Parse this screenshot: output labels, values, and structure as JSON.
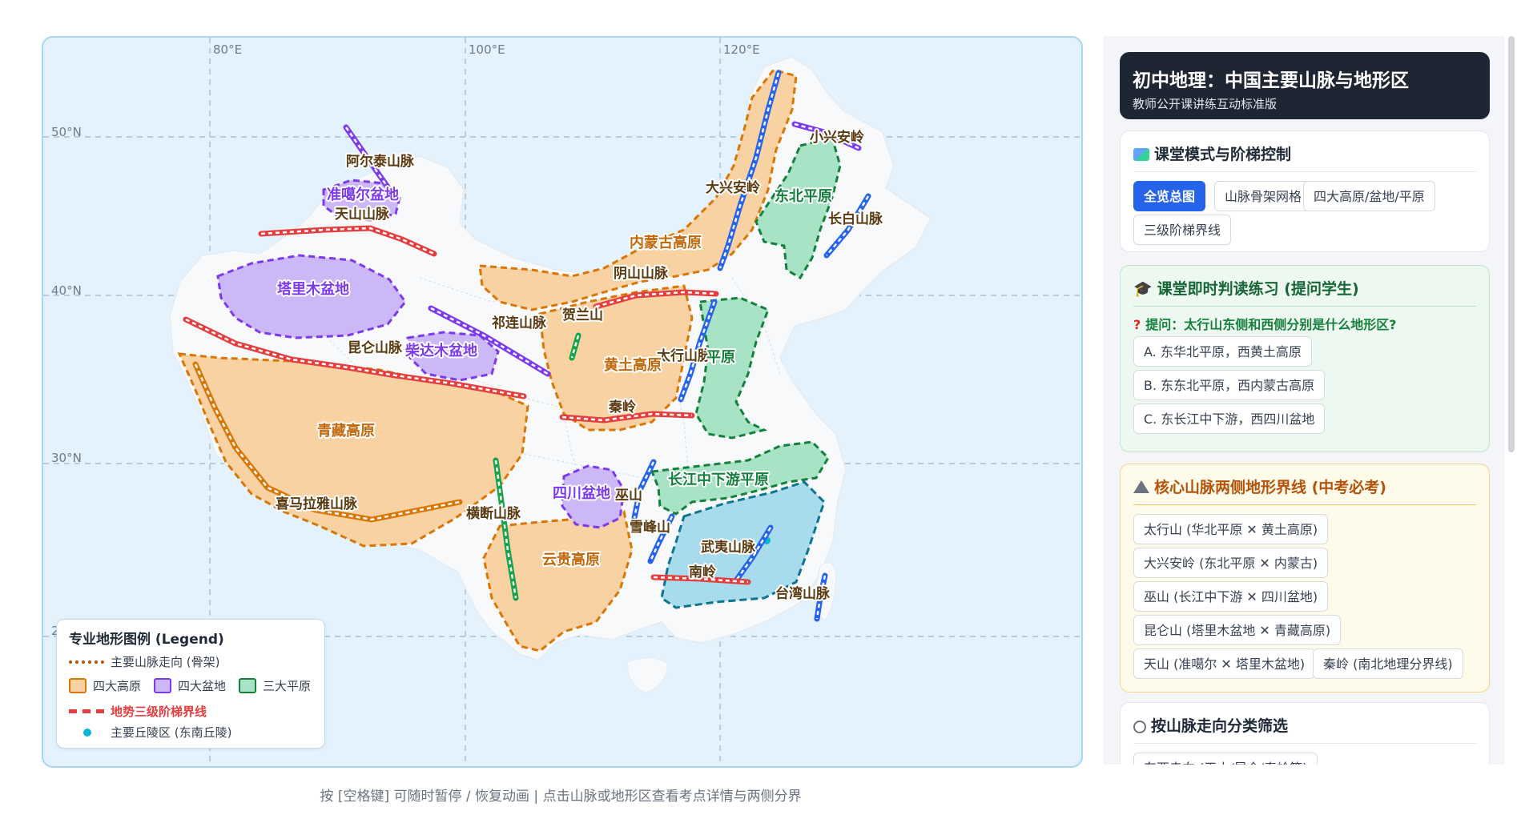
{
  "map": {
    "graticule": {
      "lon_labels": [
        "80°E",
        "100°E",
        "120°E"
      ],
      "lat_labels": [
        "50°N",
        "40°N",
        "30°N",
        "2"
      ]
    },
    "mountains": [
      {
        "id": "altai",
        "label": "阿尔泰山脉",
        "direction": "northwest-southeast",
        "color": "#7c3aed"
      },
      {
        "id": "tianshan",
        "label": "天山山脉",
        "direction": "east-west",
        "color": "#e53e3e"
      },
      {
        "id": "kunlun",
        "label": "昆仑山脉",
        "direction": "east-west",
        "color": "#e53e3e"
      },
      {
        "id": "qilian",
        "label": "祁连山脉",
        "direction": "northwest-southeast",
        "color": "#7c3aed"
      },
      {
        "id": "helan",
        "label": "贺兰山",
        "direction": "north-south",
        "color": "#16a34a"
      },
      {
        "id": "yinshan",
        "label": "阴山山脉",
        "direction": "east-west",
        "color": "#e53e3e"
      },
      {
        "id": "daxinganling",
        "label": "大兴安岭",
        "direction": "northeast-southwest",
        "color": "#2563eb"
      },
      {
        "id": "xiaoxinganling",
        "label": "小兴安岭",
        "direction": "northwest-southeast",
        "color": "#7c3aed"
      },
      {
        "id": "changbai",
        "label": "长白山脉",
        "direction": "northeast-southwest",
        "color": "#2563eb"
      },
      {
        "id": "taihang",
        "label": "太行山脉",
        "direction": "northeast-southwest",
        "color": "#2563eb"
      },
      {
        "id": "qinling",
        "label": "秦岭",
        "direction": "east-west",
        "color": "#e53e3e"
      },
      {
        "id": "wushan",
        "label": "巫山",
        "direction": "northeast-southwest",
        "color": "#2563eb"
      },
      {
        "id": "xuefeng",
        "label": "雪峰山",
        "direction": "northeast-southwest",
        "color": "#2563eb"
      },
      {
        "id": "wuyi",
        "label": "武夷山脉",
        "direction": "northeast-southwest",
        "color": "#2563eb"
      },
      {
        "id": "nanling",
        "label": "南岭",
        "direction": "east-west",
        "color": "#e53e3e"
      },
      {
        "id": "taiwan",
        "label": "台湾山脉",
        "direction": "northeast-southwest",
        "color": "#2563eb"
      },
      {
        "id": "hengduan",
        "label": "横断山脉",
        "direction": "north-south",
        "color": "#16a34a"
      },
      {
        "id": "himalaya",
        "label": "喜马拉雅山脉",
        "direction": "arc",
        "color": "#d97706"
      }
    ],
    "regions": [
      {
        "id": "qingzang",
        "label": "青藏高原",
        "kind": "plateau"
      },
      {
        "id": "neimenggu",
        "label": "内蒙古高原",
        "kind": "plateau"
      },
      {
        "id": "huangtu",
        "label": "黄土高原",
        "kind": "plateau"
      },
      {
        "id": "yungui",
        "label": "云贵高原",
        "kind": "plateau"
      },
      {
        "id": "tarim",
        "label": "塔里木盆地",
        "kind": "basin"
      },
      {
        "id": "junggar",
        "label": "准噶尔盆地",
        "kind": "basin"
      },
      {
        "id": "qaidam",
        "label": "柴达木盆地",
        "kind": "basin"
      },
      {
        "id": "sichuan",
        "label": "四川盆地",
        "kind": "basin"
      },
      {
        "id": "dongbei",
        "label": "东北平原",
        "kind": "plain"
      },
      {
        "id": "huabei",
        "label": "平原",
        "kind": "plain"
      },
      {
        "id": "changjiang",
        "label": "长江中下游平原",
        "kind": "plain"
      },
      {
        "id": "dongnan",
        "label": "东南丘陵",
        "kind": "hills"
      }
    ],
    "colors": {
      "plateau_fill": "#f8d2a3",
      "plateau_stroke": "#d97706",
      "basin_fill": "#cdb8f7",
      "basin_stroke": "#7c3aed",
      "plain_fill": "#a7e3c4",
      "plain_stroke": "#15803d",
      "hills_fill": "#a8dcec",
      "hills_stroke": "#0e7490",
      "step_line": "#e53e3e",
      "land": "#f7f9fb",
      "sea": "#e3f2fc"
    }
  },
  "legend": {
    "title": "专业地形图例 (Legend)",
    "mountain_axis": "主要山脉走向 (骨架)",
    "plateaus": "四大高原",
    "basins": "四大盆地",
    "plains": "三大平原",
    "step_line": "地势三级阶梯界线",
    "hills": "主要丘陵区 (东南丘陵)"
  },
  "footer_hint": "按 [空格键] 可随时暂停 / 恢复动画 | 点击山脉或地形区查看考点详情与两侧分界",
  "side": {
    "title": "初中地理：中国主要山脉与地形区",
    "subtitle": "教师公开课讲练互动标准版",
    "mode_section": {
      "icon": "map-icon",
      "title": "课堂模式与阶梯控制",
      "buttons": [
        "全览总图",
        "山脉骨架网格",
        "四大高原/盆地/平原",
        "三级阶梯界线"
      ],
      "active_index": 0
    },
    "quiz_section": {
      "icon": "graduation-cap-icon",
      "title": "课堂即时判读练习 (提问学生)",
      "question": "提问：太行山东侧和西侧分别是什么地形区?",
      "options": [
        "A. 东华北平原，西黄土高原",
        "B. 东东北平原，西内蒙古高原",
        "C. 东长江中下游，西四川盆地"
      ]
    },
    "line_section": {
      "icon": "mountain-icon",
      "title": "核心山脉两侧地形界线 (中考必考)",
      "items": [
        "太行山 (华北平原 ✕ 黄土高原)",
        "大兴安岭 (东北平原 ✕ 内蒙古)",
        "巫山 (长江中下游 ✕ 四川盆地)",
        "昆仑山 (塔里木盆地 ✕ 青藏高原)",
        "天山 (准噶尔 ✕ 塔里木盆地)",
        "秦岭 (南北地理分界线)"
      ]
    },
    "filter_section": {
      "icon": "compass-icon",
      "title": "按山脉走向分类筛选",
      "items": [
        "东西走向 (天山/昆仑/秦岭等)"
      ]
    }
  }
}
